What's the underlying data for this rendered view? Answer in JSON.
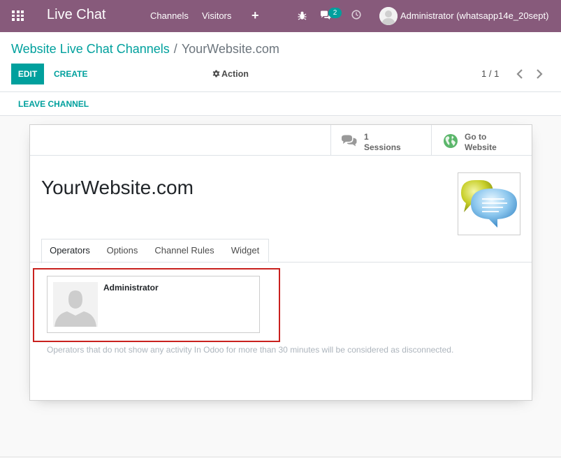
{
  "navbar": {
    "app_title": "Live Chat",
    "menu": [
      "Channels",
      "Visitors"
    ],
    "plus_label": "+",
    "messages_count": "2",
    "user_name": "Administrator (whatsapp14e_20sept)",
    "icons": [
      "apps-grid-icon",
      "bug-icon",
      "chat-bubbles-icon",
      "clock-icon"
    ]
  },
  "breadcrumb": {
    "parent": "Website Live Chat Channels",
    "separator": "/",
    "current": "YourWebsite.com"
  },
  "control_panel": {
    "edit_label": "EDIT",
    "create_label": "CREATE",
    "action_label": "Action",
    "pager_value": "1 / 1"
  },
  "statusbar": {
    "leave_label": "LEAVE CHANNEL"
  },
  "stat_buttons": {
    "sessions": {
      "value": "1",
      "label": "Sessions"
    },
    "website": {
      "line1": "Go to",
      "line2": "Website"
    }
  },
  "form": {
    "title": "YourWebsite.com",
    "tabs": [
      "Operators",
      "Options",
      "Channel Rules",
      "Widget"
    ],
    "active_tab": "Operators",
    "operators": [
      {
        "name": "Administrator"
      }
    ],
    "help_text": "Operators that do not show any activity In Odoo for more than 30 minutes will be considered as disconnected."
  },
  "colors": {
    "navbar": "#875a7b",
    "accent": "#00a09d",
    "highlight_box": "#c9211e"
  }
}
